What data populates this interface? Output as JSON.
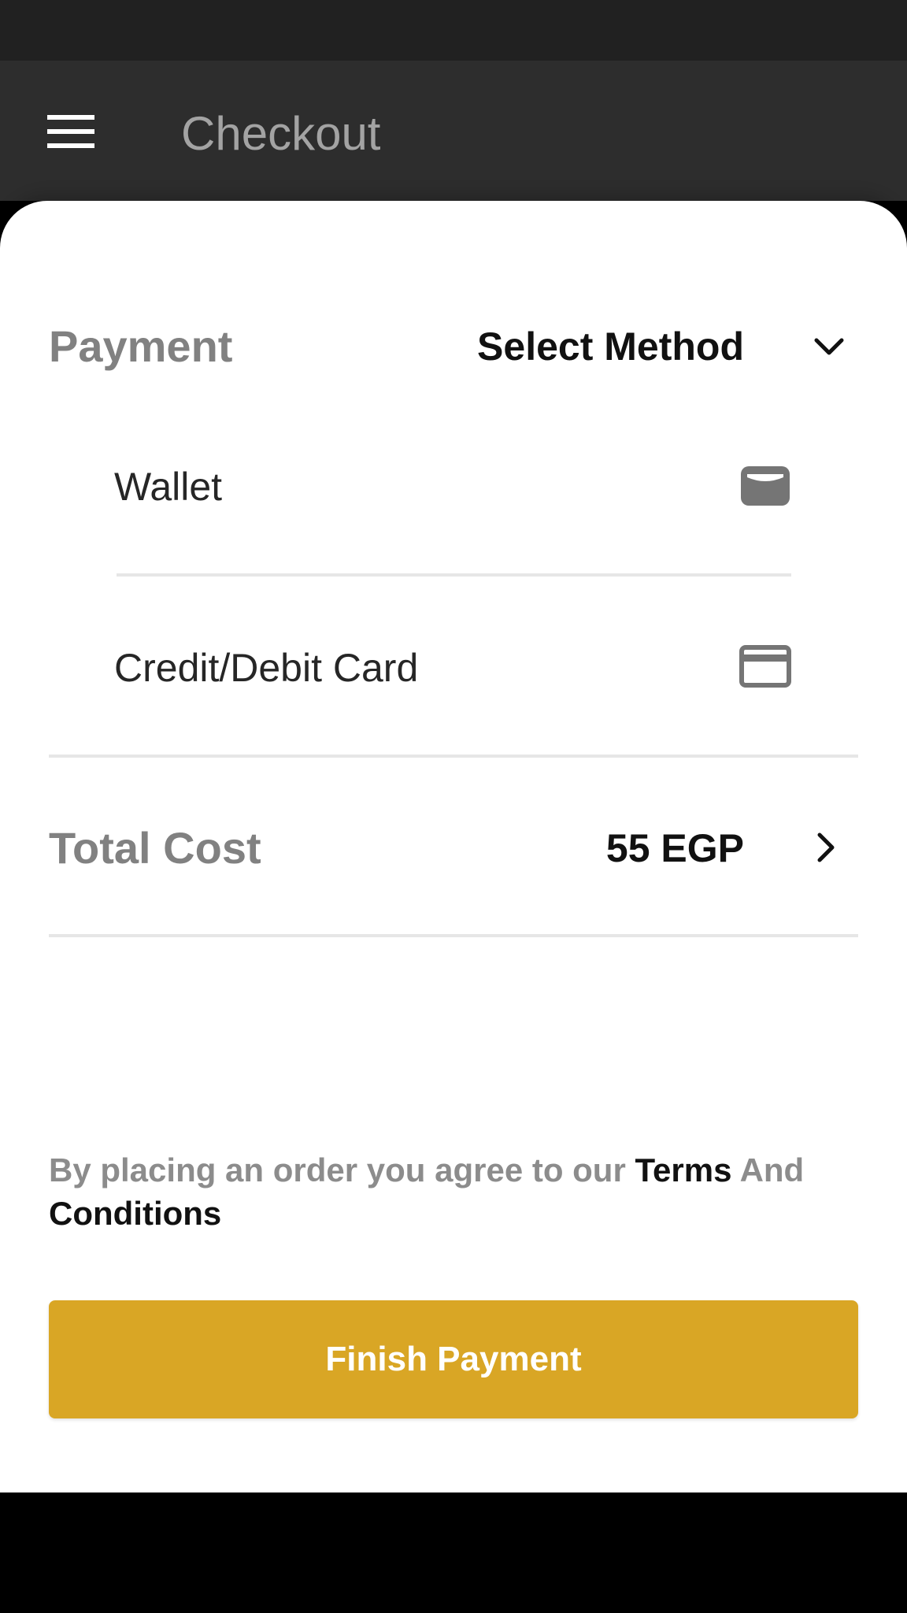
{
  "app_bar": {
    "title": "Checkout",
    "menu_icon": "hamburger-menu-icon"
  },
  "payment": {
    "label": "Payment",
    "select_label": "Select Method",
    "dropdown_icon": "chevron-down-icon",
    "methods": [
      {
        "label": "Wallet",
        "icon": "wallet-icon"
      },
      {
        "label": "Credit/Debit Card",
        "icon": "credit-card-icon"
      }
    ]
  },
  "total": {
    "label": "Total Cost",
    "value": "55 EGP",
    "icon": "chevron-right-icon"
  },
  "terms": {
    "prefix": "By placing an order you agree to our",
    "terms_link": "Terms",
    "and": "And",
    "conditions_link": "Conditions"
  },
  "finish_button": {
    "label": "Finish Payment"
  },
  "colors": {
    "status_bar": "#212121",
    "app_bar": "#2d2d2d",
    "accent": "#d9a625",
    "label_gray": "#818181",
    "nav_bar": "#000000"
  }
}
